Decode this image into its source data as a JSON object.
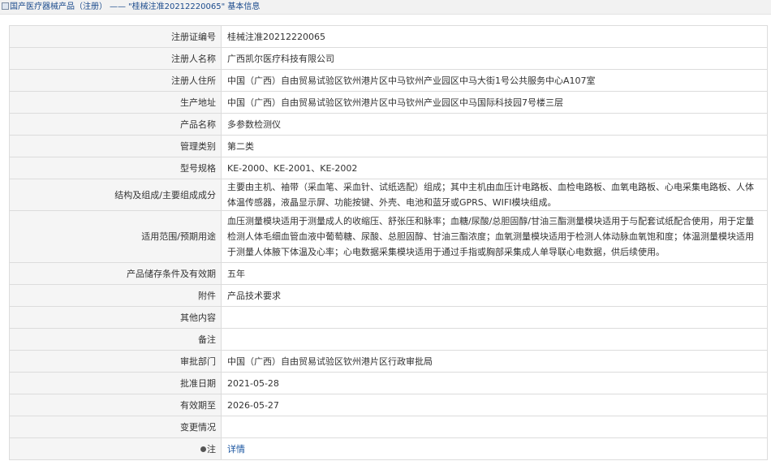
{
  "breadcrumb": {
    "root": "国产医疗器械产品（注册）",
    "separator": "——",
    "current": "\"桂械注准20212220065\" 基本信息"
  },
  "rows": [
    {
      "label": "注册证编号",
      "value": "桂械注准20212220065"
    },
    {
      "label": "注册人名称",
      "value": "广西凯尔医疗科技有限公司"
    },
    {
      "label": "注册人住所",
      "value": "中国（广西）自由贸易试验区钦州港片区中马钦州产业园区中马大街1号公共服务中心A107室"
    },
    {
      "label": "生产地址",
      "value": "中国（广西）自由贸易试验区钦州港片区中马钦州产业园区中马国际科技园7号楼三层"
    },
    {
      "label": "产品名称",
      "value": "多参数检测仪"
    },
    {
      "label": "管理类别",
      "value": "第二类"
    },
    {
      "label": "型号规格",
      "value": "KE-2000、KE-2001、KE-2002"
    },
    {
      "label": "结构及组成/主要组成成分",
      "value": "主要由主机、袖带（采血笔、采血针、试纸选配）组成；其中主机由血压计电路板、血检电路板、血氧电路板、心电采集电路板、人体体温传感器，液晶显示屏、功能按键、外壳、电池和蓝牙或GPRS、WIFI模块组成。"
    },
    {
      "label": "适用范围/预期用途",
      "value": "血压测量模块适用于测量成人的收缩压、舒张压和脉率；血糖/尿酸/总胆固醇/甘油三酯测量模块适用于与配套试纸配合使用，用于定量检测人体毛细血管血液中葡萄糖、尿酸、总胆固醇、甘油三酯浓度；血氧测量模块适用于检测人体动脉血氧饱和度；体温测量模块适用于测量人体腋下体温及心率；心电数据采集模块适用于通过手指或胸部采集成人单导联心电数据，供后续使用。"
    },
    {
      "label": "产品储存条件及有效期",
      "value": "五年"
    },
    {
      "label": "附件",
      "value": "产品技术要求"
    },
    {
      "label": "其他内容",
      "value": ""
    },
    {
      "label": "备注",
      "value": ""
    },
    {
      "label": "审批部门",
      "value": "中国（广西）自由贸易试验区钦州港片区行政审批局"
    },
    {
      "label": "批准日期",
      "value": "2021-05-28"
    },
    {
      "label": "有效期至",
      "value": "2026-05-27"
    },
    {
      "label": "变更情况",
      "value": ""
    },
    {
      "label": "注",
      "value": "详情"
    }
  ]
}
